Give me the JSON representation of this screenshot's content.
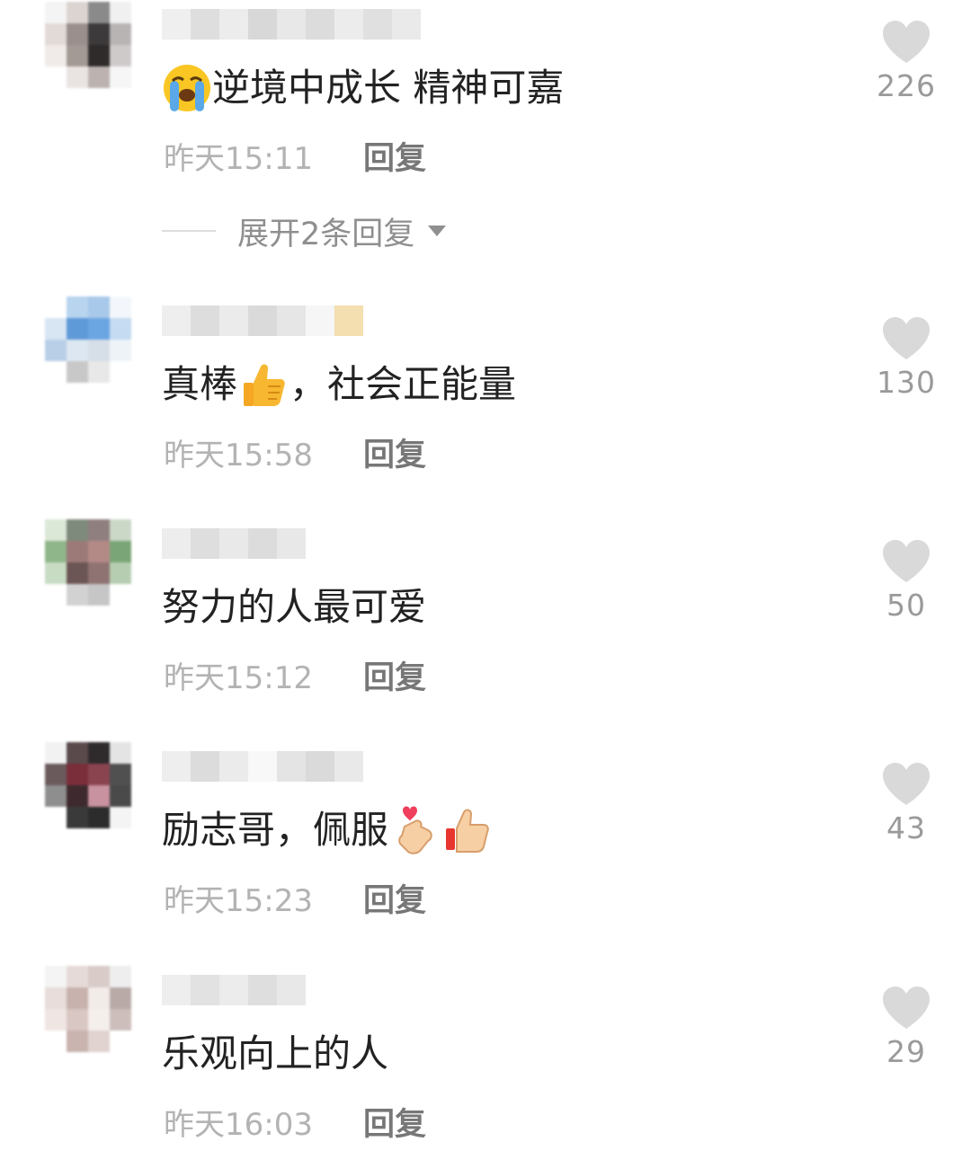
{
  "comments": [
    {
      "text": "逆境中成长 精神可嘉",
      "emoji_before": "crying-face",
      "time": "昨天15:11",
      "reply": "回复",
      "likes": "226",
      "expand_label": "展开2条回复"
    },
    {
      "text": "真棒",
      "text_after": "，社会正能量",
      "emoji_mid": "thumbs-up",
      "time": "昨天15:58",
      "reply": "回复",
      "likes": "130"
    },
    {
      "text": "努力的人最可爱",
      "time": "昨天15:12",
      "reply": "回复",
      "likes": "50"
    },
    {
      "text": "励志哥，佩服",
      "emoji_after": [
        "finger-heart",
        "thumbs-up"
      ],
      "time": "昨天15:23",
      "reply": "回复",
      "likes": "43"
    },
    {
      "text": "乐观向上的人",
      "time": "昨天16:03",
      "reply": "回复",
      "likes": "29"
    }
  ],
  "colors": {
    "comment_text": "#222222",
    "timestamp": "#b3b3b3",
    "reply": "#777777",
    "heart": "#d9d9d9",
    "like_count": "#9a9a9a"
  }
}
